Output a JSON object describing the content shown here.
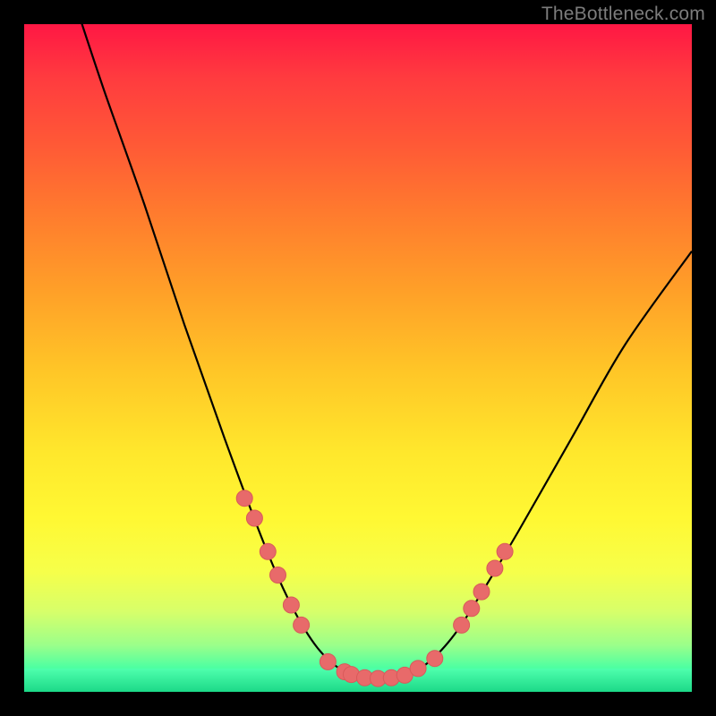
{
  "watermark": "TheBottleneck.com",
  "colors": {
    "frame": "#000000",
    "dot_fill": "#e86a6a",
    "dot_stroke": "#d85a5a",
    "curve_stroke": "#000000",
    "watermark_text": "#7c7c7c"
  },
  "chart_data": {
    "type": "line",
    "title": "",
    "xlabel": "",
    "ylabel": "",
    "xlim": [
      0,
      100
    ],
    "ylim": [
      0,
      100
    ],
    "grid": false,
    "legend": false,
    "series": [
      {
        "name": "bottleneck-curve",
        "points": [
          {
            "x": 8.0,
            "y": 102.0
          },
          {
            "x": 12.0,
            "y": 90.0
          },
          {
            "x": 18.0,
            "y": 73.0
          },
          {
            "x": 24.0,
            "y": 55.0
          },
          {
            "x": 30.0,
            "y": 38.0
          },
          {
            "x": 36.0,
            "y": 22.0
          },
          {
            "x": 40.0,
            "y": 13.0
          },
          {
            "x": 44.0,
            "y": 6.5
          },
          {
            "x": 48.0,
            "y": 3.0
          },
          {
            "x": 52.0,
            "y": 2.0
          },
          {
            "x": 56.0,
            "y": 2.2
          },
          {
            "x": 60.0,
            "y": 4.0
          },
          {
            "x": 64.0,
            "y": 8.0
          },
          {
            "x": 68.0,
            "y": 14.0
          },
          {
            "x": 74.0,
            "y": 24.0
          },
          {
            "x": 82.0,
            "y": 38.0
          },
          {
            "x": 90.0,
            "y": 52.0
          },
          {
            "x": 100.0,
            "y": 66.0
          }
        ]
      }
    ],
    "markers": [
      {
        "x": 33.0,
        "y": 29.0
      },
      {
        "x": 34.5,
        "y": 26.0
      },
      {
        "x": 36.5,
        "y": 21.0
      },
      {
        "x": 38.0,
        "y": 17.5
      },
      {
        "x": 40.0,
        "y": 13.0
      },
      {
        "x": 41.5,
        "y": 10.0
      },
      {
        "x": 45.5,
        "y": 4.5
      },
      {
        "x": 48.0,
        "y": 3.0
      },
      {
        "x": 49.0,
        "y": 2.6
      },
      {
        "x": 51.0,
        "y": 2.1
      },
      {
        "x": 53.0,
        "y": 2.0
      },
      {
        "x": 55.0,
        "y": 2.1
      },
      {
        "x": 57.0,
        "y": 2.5
      },
      {
        "x": 59.0,
        "y": 3.5
      },
      {
        "x": 61.5,
        "y": 5.0
      },
      {
        "x": 65.5,
        "y": 10.0
      },
      {
        "x": 67.0,
        "y": 12.5
      },
      {
        "x": 68.5,
        "y": 15.0
      },
      {
        "x": 70.5,
        "y": 18.5
      },
      {
        "x": 72.0,
        "y": 21.0
      }
    ],
    "marker_radius_px": 9
  }
}
